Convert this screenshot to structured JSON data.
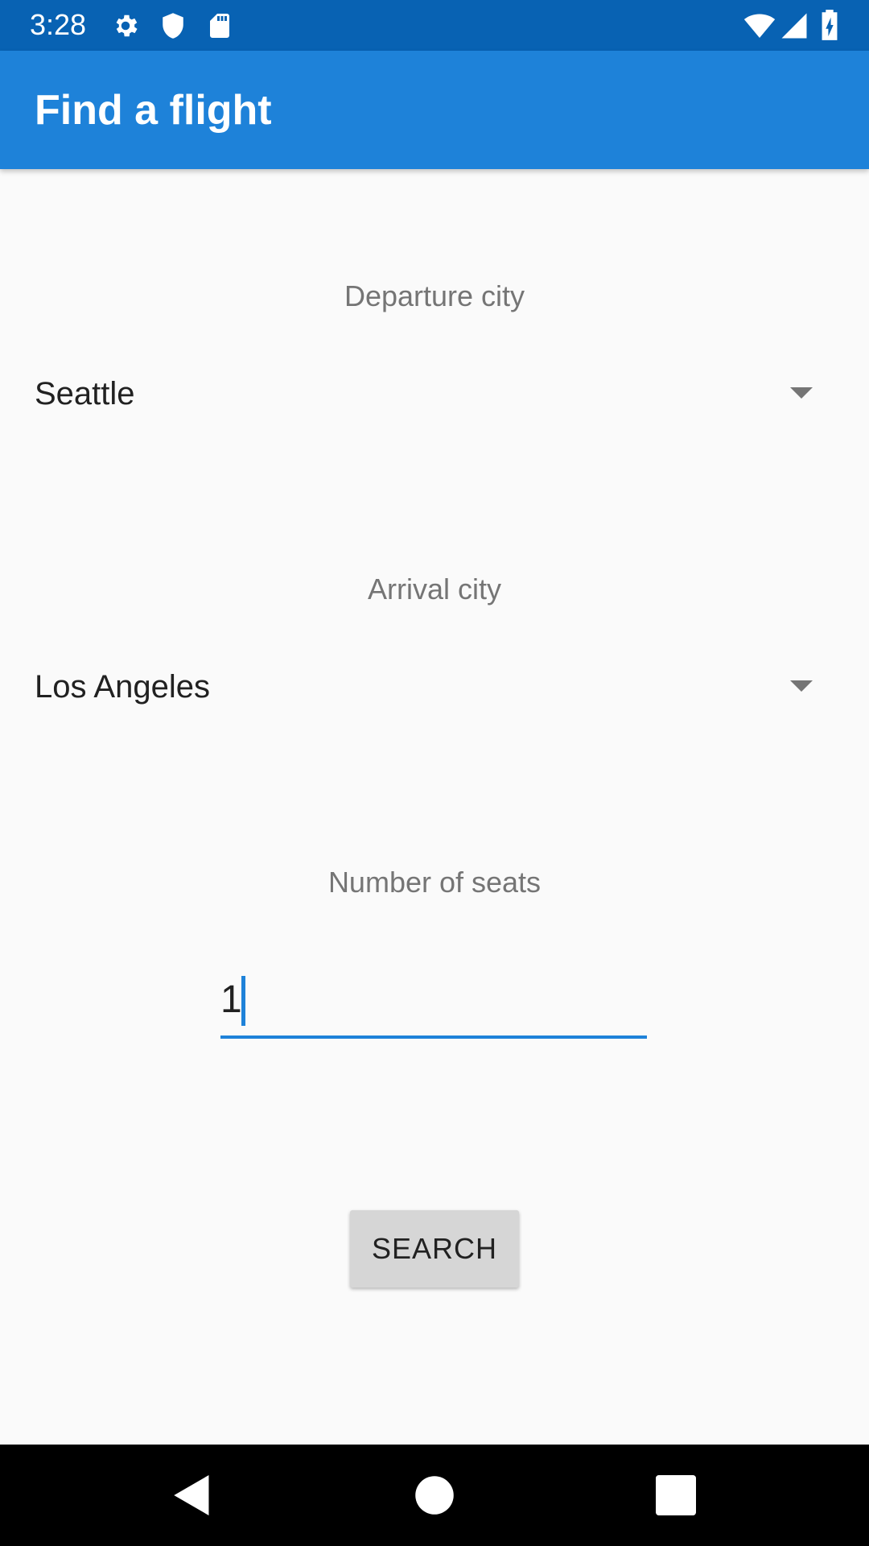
{
  "status_bar": {
    "time": "3:28",
    "left_icons": [
      "gear-icon",
      "shield-icon",
      "sd-card-icon"
    ],
    "right_icons": [
      "wifi-icon",
      "signal-icon",
      "battery-charging-icon"
    ]
  },
  "app_bar": {
    "title": "Find a flight"
  },
  "form": {
    "departure": {
      "label": "Departure city",
      "value": "Seattle"
    },
    "arrival": {
      "label": "Arrival city",
      "value": "Los Angeles"
    },
    "seats": {
      "label": "Number of seats",
      "value": "1"
    },
    "search_label": "SEARCH"
  },
  "nav_bar": {
    "icons": [
      "back-icon",
      "home-icon",
      "recents-icon"
    ]
  },
  "colors": {
    "status_bar": "#0862b3",
    "app_bar": "#1e82d9",
    "accent": "#1e82d9",
    "background": "#fafafa",
    "label": "#757575",
    "button": "#d6d6d6"
  }
}
